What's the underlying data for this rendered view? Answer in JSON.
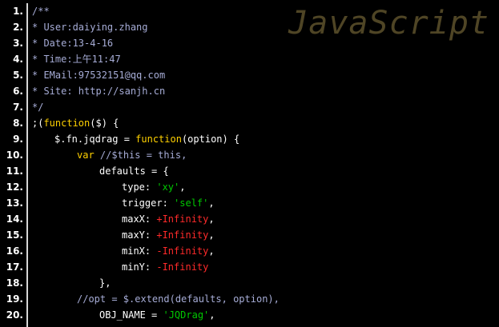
{
  "editor": {
    "watermark": "JavaScript",
    "colors": {
      "background": "#000000",
      "comment": "#a6acd6",
      "keyword": "#ffd100",
      "string": "#00c800",
      "number": "#ff2a2a",
      "plain": "#ffffff",
      "watermark": "#4f4525"
    },
    "lines": [
      {
        "number": "1.",
        "indent": 0,
        "tokens": [
          {
            "t": "/**",
            "c": "comment"
          }
        ]
      },
      {
        "number": "2.",
        "indent": 0,
        "tokens": [
          {
            "t": "* User:daiying.zhang",
            "c": "comment"
          }
        ]
      },
      {
        "number": "3.",
        "indent": 0,
        "tokens": [
          {
            "t": "* Date:13-4-16",
            "c": "comment"
          }
        ]
      },
      {
        "number": "4.",
        "indent": 0,
        "tokens": [
          {
            "t": "* Time:上午11:47",
            "c": "comment"
          }
        ]
      },
      {
        "number": "5.",
        "indent": 0,
        "tokens": [
          {
            "t": "* EMail:97532151@qq.com",
            "c": "comment"
          }
        ]
      },
      {
        "number": "6.",
        "indent": 0,
        "tokens": [
          {
            "t": "* Site: http://sanjh.cn",
            "c": "comment"
          }
        ]
      },
      {
        "number": "7.",
        "indent": 0,
        "tokens": [
          {
            "t": "*/",
            "c": "comment"
          }
        ]
      },
      {
        "number": "8.",
        "indent": 0,
        "tokens": [
          {
            "t": ";(",
            "c": "plain"
          },
          {
            "t": "function",
            "c": "keyword"
          },
          {
            "t": "($) {",
            "c": "plain"
          }
        ]
      },
      {
        "number": "9.",
        "indent": 1,
        "tokens": [
          {
            "t": "$.fn.jqdrag = ",
            "c": "plain"
          },
          {
            "t": "function",
            "c": "keyword"
          },
          {
            "t": "(option) {",
            "c": "plain"
          }
        ]
      },
      {
        "number": "10.",
        "indent": 2,
        "tokens": [
          {
            "t": "var",
            "c": "keyword"
          },
          {
            "t": " ",
            "c": "plain"
          },
          {
            "t": "//$this = this,",
            "c": "comment"
          }
        ]
      },
      {
        "number": "11.",
        "indent": 3,
        "tokens": [
          {
            "t": "defaults = {",
            "c": "plain"
          }
        ]
      },
      {
        "number": "12.",
        "indent": 4,
        "tokens": [
          {
            "t": "type: ",
            "c": "plain"
          },
          {
            "t": "'xy'",
            "c": "string"
          },
          {
            "t": ",",
            "c": "plain"
          }
        ]
      },
      {
        "number": "13.",
        "indent": 4,
        "tokens": [
          {
            "t": "trigger: ",
            "c": "plain"
          },
          {
            "t": "'self'",
            "c": "string"
          },
          {
            "t": ",",
            "c": "plain"
          }
        ]
      },
      {
        "number": "14.",
        "indent": 4,
        "tokens": [
          {
            "t": "maxX: ",
            "c": "plain"
          },
          {
            "t": "+Infinity",
            "c": "number"
          },
          {
            "t": ",",
            "c": "plain"
          }
        ]
      },
      {
        "number": "15.",
        "indent": 4,
        "tokens": [
          {
            "t": "maxY: ",
            "c": "plain"
          },
          {
            "t": "+Infinity",
            "c": "number"
          },
          {
            "t": ",",
            "c": "plain"
          }
        ]
      },
      {
        "number": "16.",
        "indent": 4,
        "tokens": [
          {
            "t": "minX: ",
            "c": "plain"
          },
          {
            "t": "-Infinity",
            "c": "number"
          },
          {
            "t": ",",
            "c": "plain"
          }
        ]
      },
      {
        "number": "17.",
        "indent": 4,
        "tokens": [
          {
            "t": "minY: ",
            "c": "plain"
          },
          {
            "t": "-Infinity",
            "c": "number"
          }
        ]
      },
      {
        "number": "18.",
        "indent": 3,
        "tokens": [
          {
            "t": "},",
            "c": "plain"
          }
        ]
      },
      {
        "number": "19.",
        "indent": 2,
        "tokens": [
          {
            "t": "//opt = $.extend(defaults, option),",
            "c": "comment"
          }
        ]
      },
      {
        "number": "20.",
        "indent": 3,
        "tokens": [
          {
            "t": "OBJ_NAME = ",
            "c": "plain"
          },
          {
            "t": "'JQDrag'",
            "c": "string"
          },
          {
            "t": ",",
            "c": "plain"
          }
        ]
      }
    ]
  }
}
